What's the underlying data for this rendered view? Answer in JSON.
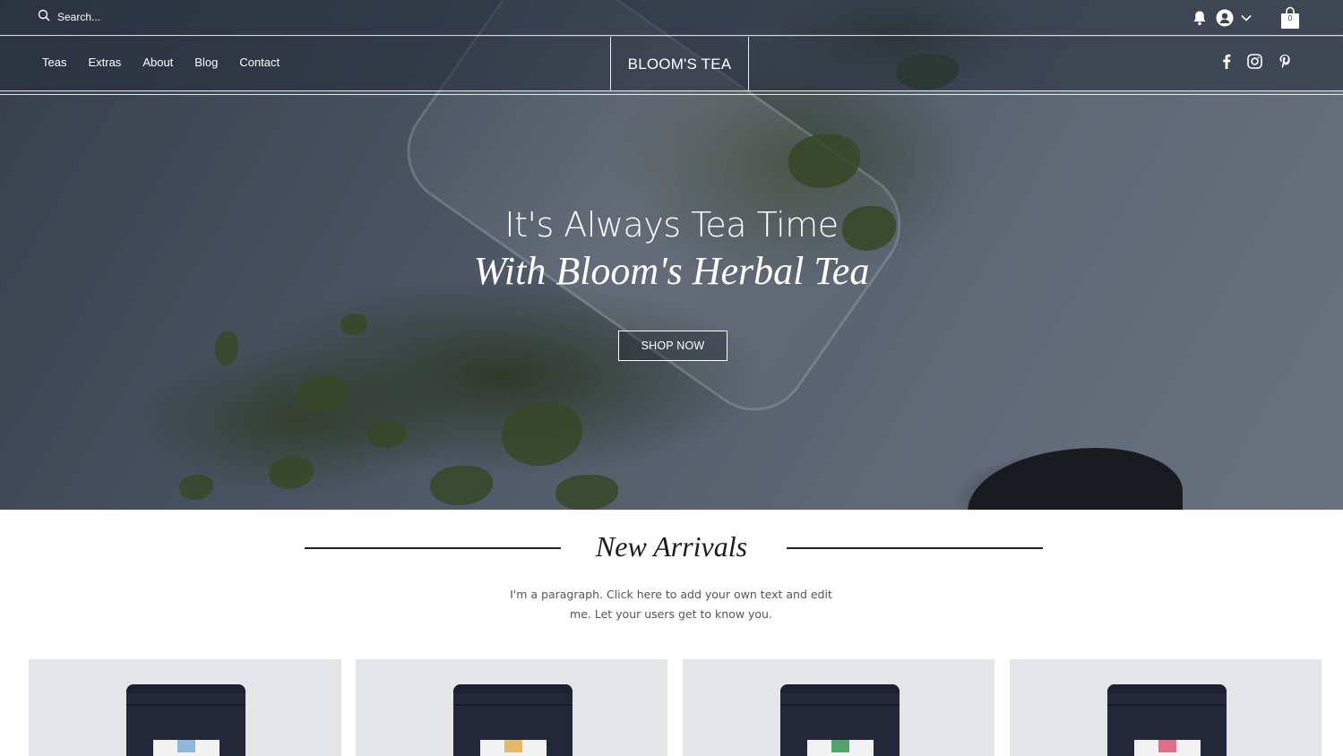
{
  "topbar": {
    "search_placeholder": "Search...",
    "cart_count": "0"
  },
  "nav": {
    "menu": [
      "Teas",
      "Extras",
      "About",
      "Blog",
      "Contact"
    ],
    "brand": "BLOOM'S TEA"
  },
  "hero": {
    "title_line1": "It's Always Tea Time",
    "title_line2": "With Bloom's Herbal Tea",
    "cta": "SHOP NOW"
  },
  "new_arrivals": {
    "heading": "New Arrivals",
    "paragraph": "I'm a paragraph. Click here to add your own text and edit me. Let your users get to know you."
  },
  "products": [
    {
      "accent": "#8fb7d8"
    },
    {
      "accent": "#e3b866"
    },
    {
      "accent": "#4fa36b"
    },
    {
      "accent": "#df6e8a"
    }
  ],
  "icons": [
    "search-icon",
    "bell-icon",
    "user-avatar-icon",
    "chevron-down-icon",
    "shopping-bag-icon",
    "facebook-icon",
    "instagram-icon",
    "pinterest-icon"
  ]
}
